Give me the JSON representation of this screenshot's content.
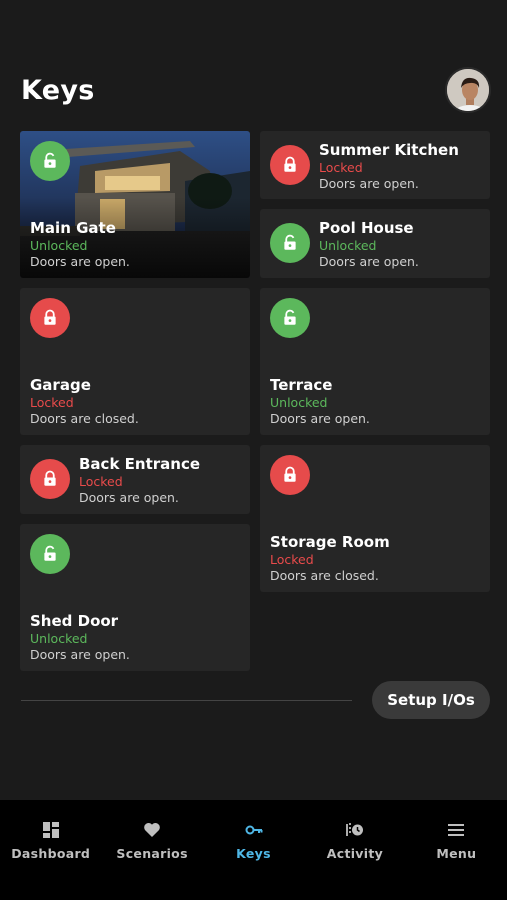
{
  "header": {
    "title": "Keys"
  },
  "keys": [
    {
      "name": "Main Gate",
      "status": "Unlocked",
      "door": "Doors are open."
    },
    {
      "name": "Summer Kitchen",
      "status": "Locked",
      "door": "Doors are open."
    },
    {
      "name": "Pool House",
      "status": "Unlocked",
      "door": "Doors are open."
    },
    {
      "name": "Garage",
      "status": "Locked",
      "door": "Doors are closed."
    },
    {
      "name": "Terrace",
      "status": "Unlocked",
      "door": "Doors are open."
    },
    {
      "name": "Back Entrance",
      "status": "Locked",
      "door": "Doors are open."
    },
    {
      "name": "Storage Room",
      "status": "Locked",
      "door": "Doors are closed."
    },
    {
      "name": "Shed Door",
      "status": "Unlocked",
      "door": "Doors are open."
    }
  ],
  "setup_button": "Setup I/Os",
  "nav": [
    {
      "label": "Dashboard",
      "icon": "dashboard-icon"
    },
    {
      "label": "Scenarios",
      "icon": "heart-icon"
    },
    {
      "label": "Keys",
      "icon": "key-icon",
      "active": true
    },
    {
      "label": "Activity",
      "icon": "activity-icon"
    },
    {
      "label": "Menu",
      "icon": "menu-icon"
    }
  ],
  "colors": {
    "background": "#1b1b1b",
    "card": "#262626",
    "locked": "#e64b4b",
    "unlocked": "#5cb85c",
    "accent": "#4fb7e6"
  }
}
